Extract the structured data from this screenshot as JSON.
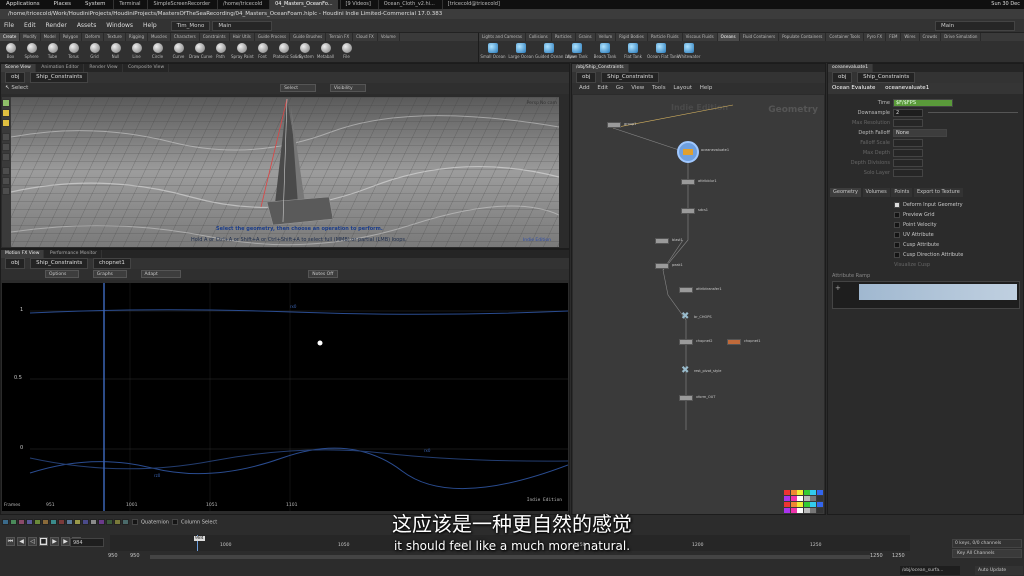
{
  "os": {
    "activities": "Applications",
    "places": "Places",
    "system": "System",
    "taskbar": [
      "Terminal",
      "SimpleScreenRecorder",
      "/home/tricecold",
      "04_Masters_OceanFo...",
      "[9 Videos]",
      "Ocean_Cloth_v2.hi...",
      "[tricecold@tricecold]"
    ],
    "clock": "Sun 30 Dec"
  },
  "window": {
    "title": "/home/tricecold/Work/HoudiniProjects/HoudiniProjects/MastersOfTheSeaRecording/04_Masters_OceanFoam.hiplc - Houdini Indie Limited-Commercial 17.0.383"
  },
  "menu": {
    "items": [
      "File",
      "Edit",
      "Render",
      "Assets",
      "Windows",
      "Help"
    ],
    "desktop": "Tim_Mono",
    "main": "Main",
    "right_main": "Main"
  },
  "shelf": {
    "left_tabs": [
      "Create",
      "Modify",
      "Model",
      "Polygon",
      "Deform",
      "Texture",
      "Rigging",
      "Muscles",
      "Characters",
      "Constraints",
      "Hair Utils",
      "Guide Process",
      "Guide Brushes",
      "Terrain FX",
      "Cloud FX",
      "Volume"
    ],
    "left_tools": [
      "Box",
      "Sphere",
      "Tube",
      "Torus",
      "Grid",
      "Null",
      "Line",
      "Circle",
      "Curve",
      "Draw Curve",
      "Path",
      "Spray Paint",
      "Font",
      "Platonic Solids",
      "L-System",
      "Metaball",
      "File"
    ],
    "right_tabs": [
      "Lights and Cameras",
      "Collisions",
      "Particles",
      "Grains",
      "Vellum",
      "Rigid Bodies",
      "Particle Fluids",
      "Viscous Fluids",
      "Oceans",
      "Fluid Containers",
      "Populate Containers",
      "Container Tools",
      "Pyro FX",
      "FEM",
      "Wires",
      "Crowds",
      "Drive Simulation"
    ],
    "right_tools": [
      "Small Ocean",
      "Large Ocean",
      "Guided Ocean Layer",
      "Wave Tank",
      "Beach Tank",
      "Flat Tank",
      "Ocean Flat Tank",
      "Whitewater"
    ]
  },
  "viewport": {
    "tabs": [
      "Scene View",
      "Animation Editor",
      "Render View",
      "Composite View"
    ],
    "path": [
      "obj",
      "Ship_Constraints"
    ],
    "mode": "Select",
    "select_dd": "Select",
    "visibility_dd": "Visibility",
    "persp": "Persp",
    "nocam": "No cam",
    "hint1": "Select the geometry, then choose an operation to perform.",
    "hint2": "Hold A or Ctrl+A or Shift+A or Ctrl+Shift+A to select full (MMB) or partial (LMB) loops.",
    "edition": "Indie Edition"
  },
  "motion": {
    "tabs": [
      "Motion FX View",
      "Performance Monitor"
    ],
    "path": [
      "obj",
      "Ship_Constraints",
      "chopnet1"
    ],
    "options": "Options",
    "graphs": "Graphs",
    "adapt": "Adapt",
    "notes": "Notes Off",
    "yticks": [
      "1",
      "0.5",
      "0"
    ],
    "xticks": [
      "951",
      "1001",
      "1051",
      "1101"
    ],
    "frames_label": "Frames",
    "edition": "Indie Edition",
    "curve_labels": [
      "rx0",
      "rz0",
      "rx0"
    ],
    "quaternion": "Quaternion",
    "column_select": "Column Select"
  },
  "network": {
    "menu": [
      "Add",
      "Edit",
      "Go",
      "View",
      "Tools",
      "Layout",
      "Help"
    ],
    "path": [
      "obj",
      "Ship_Constraints"
    ],
    "edition": "Indie Edition",
    "context": "Geometry",
    "nodes": [
      "group1",
      "oceanevaluate1",
      "attribblur1",
      "sdcs1",
      "blast1",
      "peak1",
      "attribtransfer1",
      "br_CHOPS",
      "chopnet2",
      "chopnet1",
      "rest_pivot_style",
      "xform_OUT"
    ]
  },
  "params": {
    "tab": "oceanevaluate1",
    "path": [
      "obj",
      "Ship_Constraints"
    ],
    "type": "Ocean Evaluate",
    "name": "oceanevaluate1",
    "rows": [
      {
        "label": "Time",
        "value": "$F/$FPS"
      },
      {
        "label": "Downsample",
        "value": "2"
      },
      {
        "label": "Max Resolution",
        "value": ""
      },
      {
        "label": "Depth Falloff",
        "value": "None"
      },
      {
        "label": "Falloff Scale",
        "value": ""
      },
      {
        "label": "Max Depth",
        "value": ""
      },
      {
        "label": "Depth Divisions",
        "value": ""
      },
      {
        "label": "Solo Layer",
        "value": ""
      }
    ],
    "subtabs": [
      "Geometry",
      "Volumes",
      "Points",
      "Export to Texture"
    ],
    "checks": [
      {
        "label": "Deform Input Geometry",
        "on": true
      },
      {
        "label": "Preview Grid",
        "on": false
      },
      {
        "label": "Point Velocity",
        "on": false
      },
      {
        "label": "UV Attribute",
        "on": false
      },
      {
        "label": "Cusp Attribute",
        "on": false
      },
      {
        "label": "Cusp Direction Attribute",
        "on": false
      },
      {
        "label": "Visualize Cusp",
        "on": false
      }
    ],
    "ramp_label": "Attribute Ramp"
  },
  "timeline": {
    "frame": "984",
    "start": "950",
    "end": "1250",
    "ticks": [
      "1000",
      "1050",
      "1100",
      "1150",
      "1200",
      "1250"
    ],
    "keys": "0 keys, 0/0 channels",
    "key_all": "Key All Channels",
    "path": "/obj/ocean_surfa...",
    "auto_update": "Auto Update",
    "range_end": "1250",
    "range_start": "950"
  },
  "subtitle": {
    "cn": "这应该是一种更自然的感觉",
    "en": "it should feel like a much more natural."
  },
  "colors": {
    "accent_blue": "#3a64b4",
    "node_selected": "#6ea0e0",
    "ocean_node": "#e0a030"
  }
}
